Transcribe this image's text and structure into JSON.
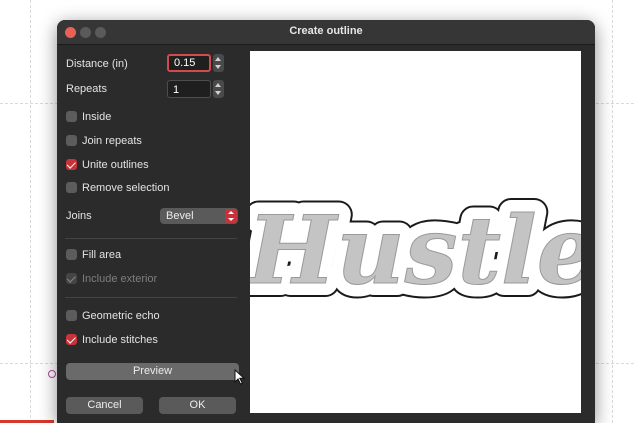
{
  "dialog": {
    "title": "Create outline",
    "distance": {
      "label": "Distance (in)",
      "value": "0.15"
    },
    "repeats": {
      "label": "Repeats",
      "value": "1"
    },
    "options": {
      "inside": {
        "label": "Inside",
        "checked": false
      },
      "join_repeats": {
        "label": "Join repeats",
        "checked": false
      },
      "unite_outlines": {
        "label": "Unite outlines",
        "checked": true
      },
      "remove_selection": {
        "label": "Remove selection",
        "checked": false
      }
    },
    "joins": {
      "label": "Joins",
      "value": "Bevel"
    },
    "fill_area": {
      "label": "Fill area",
      "checked": false
    },
    "include_exterior": {
      "label": "Include exterior",
      "checked": true,
      "disabled": true
    },
    "geometric_echo": {
      "label": "Geometric echo",
      "checked": false
    },
    "include_stitches": {
      "label": "Include stitches",
      "checked": true
    },
    "buttons": {
      "preview": "Preview",
      "cancel": "Cancel",
      "ok": "OK"
    },
    "preview_text": "Hustle"
  },
  "colors": {
    "accent": "#c8323a",
    "dialog_bg": "#2b2b2b",
    "preview_fill": "#c4c4c4"
  }
}
